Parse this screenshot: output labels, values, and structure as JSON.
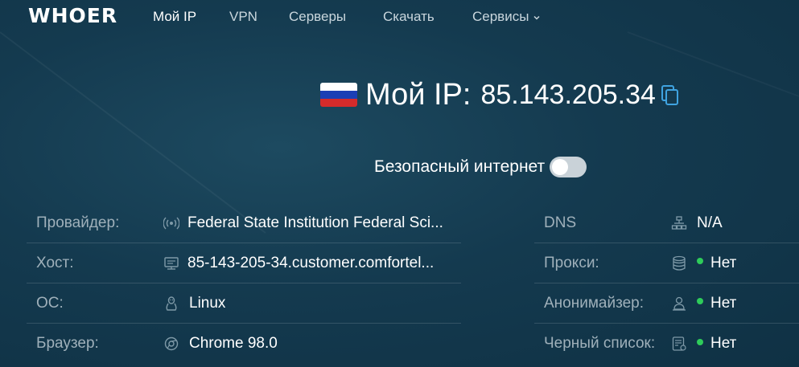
{
  "brand": {
    "logo": "WHOER"
  },
  "nav": {
    "items": [
      {
        "label": "Мой IP",
        "active": true
      },
      {
        "label": "VPN"
      },
      {
        "label": "Серверы"
      },
      {
        "label": "Скачать"
      },
      {
        "label": "Сервисы",
        "dropdown": true
      }
    ]
  },
  "ip": {
    "flag": "russia-flag",
    "label": "Мой IP:",
    "value": "85.143.205.34"
  },
  "safe_internet": {
    "label": "Безопасный интернет",
    "enabled": false
  },
  "details_left": [
    {
      "label": "Провайдер:",
      "icon": "signal-icon",
      "value": "Federal State Institution Federal Sci..."
    },
    {
      "label": "Хост:",
      "icon": "server-icon",
      "value": "85-143-205-34.customer.comfortel..."
    },
    {
      "label": "ОС:",
      "icon": "linux-icon",
      "value": "Linux"
    },
    {
      "label": "Браузер:",
      "icon": "browser-icon",
      "value": "Chrome 98.0"
    }
  ],
  "details_right": [
    {
      "label": "DNS",
      "icon": "network-icon",
      "value": "N/A"
    },
    {
      "label": "Прокси:",
      "icon": "database-icon",
      "value": "Нет",
      "status": "green"
    },
    {
      "label": "Анонимайзер:",
      "icon": "user-icon",
      "value": "Нет",
      "status": "green"
    },
    {
      "label": "Черный список:",
      "icon": "list-icon",
      "value": "Нет",
      "status": "green"
    }
  ],
  "colors": {
    "status_ok": "#2ecc5a",
    "background": "#143a4f"
  }
}
